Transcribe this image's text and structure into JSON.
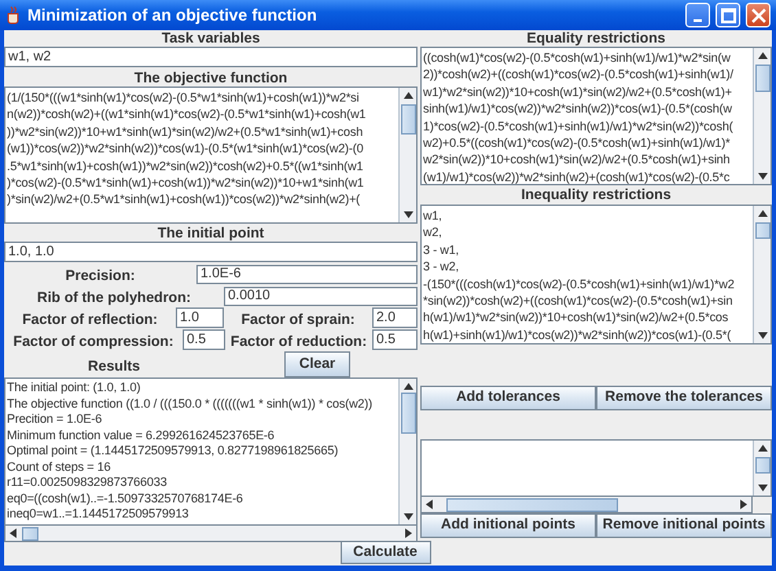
{
  "window": {
    "title": "Minimization of an objective function"
  },
  "task_variables": {
    "heading": "Task variables",
    "value": "w1, w2"
  },
  "objective_function": {
    "heading": "The objective function",
    "lines": [
      "(1/(150*(((w1*sinh(w1)*cos(w2)-(0.5*w1*sinh(w1)+cosh(w1))*w2*si",
      "n(w2))*cosh(w2)+((w1*sinh(w1)*cos(w2)-(0.5*w1*sinh(w1)+cosh(w1",
      "))*w2*sin(w2))*10+w1*sinh(w1)*sin(w2)/w2+(0.5*w1*sinh(w1)+cosh",
      "(w1))*cos(w2))*w2*sinh(w2))*cos(w1)-(0.5*(w1*sinh(w1)*cos(w2)-(0",
      ".5*w1*sinh(w1)+cosh(w1))*w2*sin(w2))*cosh(w2)+0.5*((w1*sinh(w1",
      ")*cos(w2)-(0.5*w1*sinh(w1)+cosh(w1))*w2*sin(w2))*10+w1*sinh(w1",
      ")*sin(w2)/w2+(0.5*w1*sinh(w1)+cosh(w1))*cos(w2))*w2*sinh(w2)+("
    ]
  },
  "initial_point": {
    "heading": "The initial point",
    "value": "1.0, 1.0"
  },
  "parameters": [
    {
      "label": "Precision:",
      "value": "1.0E-6"
    },
    {
      "label": "Rib of the polyhedron:",
      "value": "0.0010"
    }
  ],
  "factor_rows": [
    {
      "items": [
        {
          "label": "Factor of reflection:",
          "value": "1.0"
        },
        {
          "label": "Factor of sprain:",
          "value": "2.0"
        }
      ]
    },
    {
      "items": [
        {
          "label": "Factor of compression:",
          "value": "0.5"
        },
        {
          "label": "Factor of reduction:",
          "value": "0.5"
        }
      ]
    }
  ],
  "results": {
    "heading": "Results",
    "clear_button": "Clear",
    "lines": [
      "The initial point: (1.0, 1.0)",
      "The objective function ((1.0 / (((150.0 * (((((((w1 * sinh(w1)) * cos(w2))",
      "Precition = 1.0E-6",
      "Minimum function value = 6.299261624523765E-6",
      "Optimal point = (1.1445172509579913, 0.8277198961825665)",
      "Count of steps = 16",
      "r11=0.0025098329873766033",
      "eq0=((cosh(w1)..=-1.5097332570768174E-6",
      "ineq0=w1..=1.1445172509579913"
    ]
  },
  "equality_restrictions": {
    "heading": "Equality restrictions",
    "lines": [
      "((cosh(w1)*cos(w2)-(0.5*cosh(w1)+sinh(w1)/w1)*w2*sin(w",
      "2))*cosh(w2)+((cosh(w1)*cos(w2)-(0.5*cosh(w1)+sinh(w1)/",
      "w1)*w2*sin(w2))*10+cosh(w1)*sin(w2)/w2+(0.5*cosh(w1)+",
      "sinh(w1)/w1)*cos(w2))*w2*sinh(w2))*cos(w1)-(0.5*(cosh(w",
      "1)*cos(w2)-(0.5*cosh(w1)+sinh(w1)/w1)*w2*sin(w2))*cosh(",
      "w2)+0.5*((cosh(w1)*cos(w2)-(0.5*cosh(w1)+sinh(w1)/w1)*",
      "w2*sin(w2))*10+cosh(w1)*sin(w2)/w2+(0.5*cosh(w1)+sinh",
      "(w1)/w1)*cos(w2))*w2*sinh(w2)+(cosh(w1)*cos(w2)-(0.5*c"
    ]
  },
  "inequality_restrictions": {
    "heading": "Inequality restrictions",
    "lines": [
      "w1,",
      "w2,",
      "3 - w1,",
      "3 - w2,",
      "-(150*(((cosh(w1)*cos(w2)-(0.5*cosh(w1)+sinh(w1)/w1)*w2",
      "*sin(w2))*cosh(w2)+((cosh(w1)*cos(w2)-(0.5*cosh(w1)+sin",
      "h(w1)/w1)*w2*sin(w2))*10+cosh(w1)*sin(w2)/w2+(0.5*cos",
      "h(w1)+sinh(w1)/w1)*cos(w2))*w2*sinh(w2))*cos(w1)-(0.5*("
    ]
  },
  "tolerance_buttons": [
    "Add tolerances",
    "Remove the tolerances"
  ],
  "initial_points_buttons": [
    "Add initional points",
    "Remove initional points"
  ],
  "calculate_button": "Calculate"
}
